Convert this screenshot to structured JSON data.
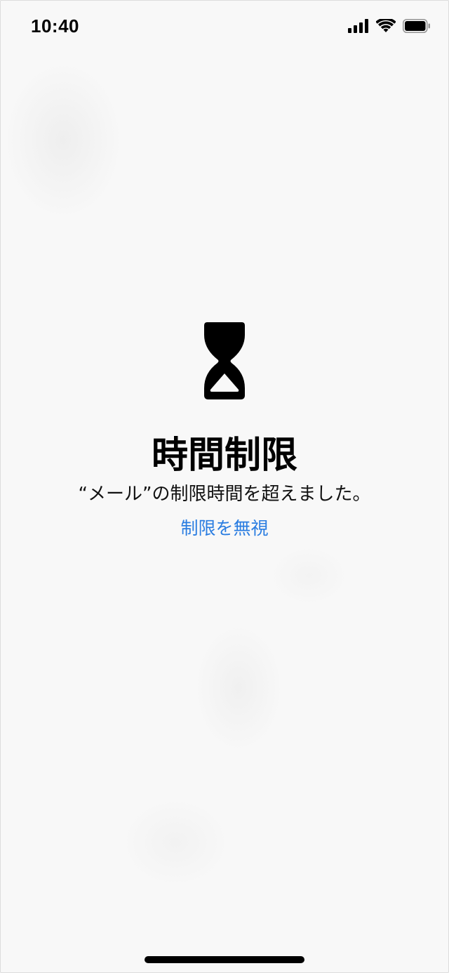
{
  "status_bar": {
    "time": "10:40",
    "icons": [
      "signal-icon",
      "wifi-icon",
      "battery-icon"
    ]
  },
  "screen_time": {
    "icon": "hourglass-icon",
    "title": "時間制限",
    "message": "“メール”の制限時間を超えました。",
    "ignore_limit_label": "制限を無視"
  },
  "colors": {
    "background": "#f8f8f8",
    "text": "#000000",
    "link": "#2a7de1"
  }
}
